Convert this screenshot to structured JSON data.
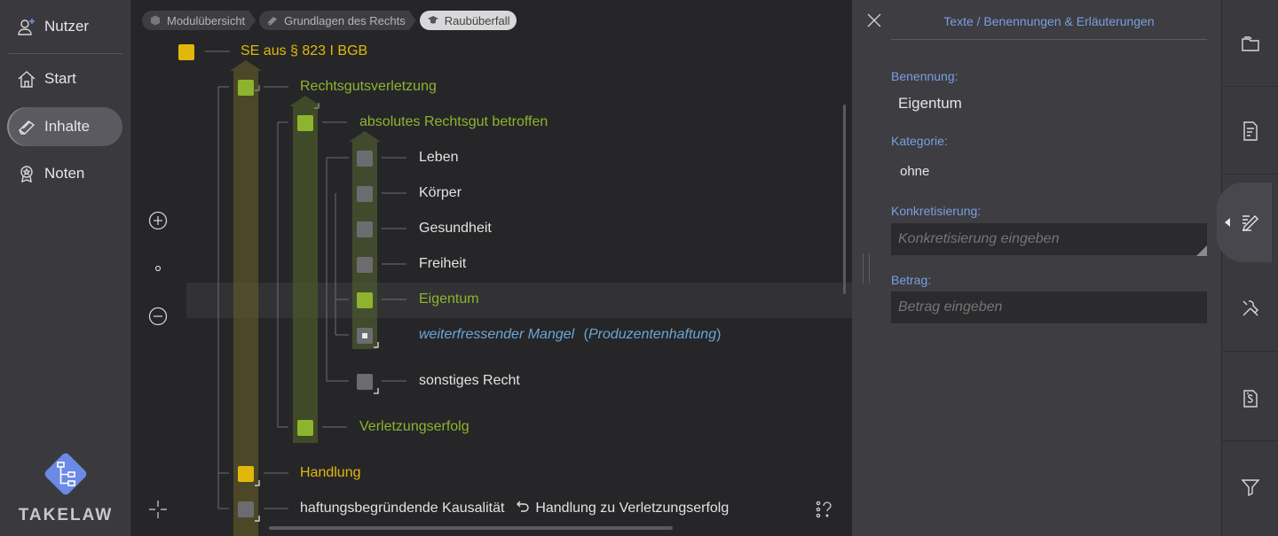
{
  "sidebar": {
    "items": [
      {
        "label": "Nutzer",
        "icon": "user-add-icon"
      },
      {
        "label": "Start",
        "icon": "home-icon"
      },
      {
        "label": "Inhalte",
        "icon": "book-icon",
        "active": true
      },
      {
        "label": "Noten",
        "icon": "award-icon"
      }
    ],
    "logo_text": "TAKELAW"
  },
  "breadcrumbs": [
    {
      "label": "Modulübersicht",
      "icon": "box-icon"
    },
    {
      "label": "Grundlagen des Rechts",
      "icon": "book-icon"
    },
    {
      "label": "Raubüberfall",
      "icon": "graduation-cap-icon"
    }
  ],
  "tree": {
    "root": "SE aus § 823 I BGB",
    "rechtsgutsverletzung": "Rechtsgutsverletzung",
    "absolutes": "absolutes Rechtsgut betroffen",
    "leben": "Leben",
    "koerper": "Körper",
    "gesundheit": "Gesundheit",
    "freiheit": "Freiheit",
    "eigentum": "Eigentum",
    "weiterfressender": "weiterfressender Mangel",
    "produzentenhaftung": "Produzentenhaftung",
    "paren_open": "(",
    "paren_close": ")",
    "sonstiges": "sonstiges Recht",
    "verletzungserfolg": "Verletzungserfolg",
    "handlung": "Handlung",
    "kausalitaet": "haftungsbegründende Kausalität",
    "kausalitaet_link": "Handlung zu Verletzungserfolg"
  },
  "colors": {
    "yellow": "#e2b70c",
    "green": "#8db42f",
    "gray": "#6c6c70",
    "link_blue": "#6ba6d6",
    "panel_accent": "#7a9fe0"
  },
  "panel": {
    "title": "Texte / Benennungen & Erläuterungen",
    "benennung_label": "Benennung:",
    "benennung_value": "Eigentum",
    "kategorie_label": "Kategorie:",
    "kategorie_value": "ohne",
    "konkretisierung_label": "Konkretisierung:",
    "konkretisierung_placeholder": "Konkretisierung eingeben",
    "betrag_label": "Betrag:",
    "betrag_placeholder": "Betrag eingeben"
  },
  "toolbar": {
    "items": [
      "folder-icon",
      "document-icon",
      "edit-icon",
      "tools-icon",
      "paragraph-doc-icon",
      "filter-icon"
    ],
    "active": "edit-icon"
  },
  "help": "?"
}
